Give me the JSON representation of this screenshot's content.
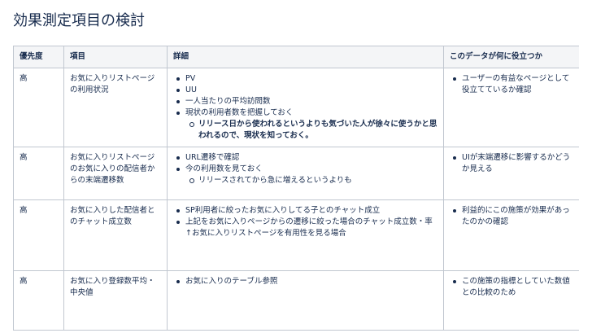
{
  "page": {
    "title": "効果測定項目の検討"
  },
  "table": {
    "headers": {
      "priority": "優先度",
      "item": "項目",
      "detail": "詳細",
      "usage": "このデータが何に役立つか"
    },
    "rows": [
      {
        "priority": "高",
        "item": "お気に入りリストページの利用状況",
        "detail": {
          "bullets": [
            "PV",
            "UU",
            "一人当たりの平均訪問数",
            "現状の利用者数を把握しておく"
          ],
          "sub": "リリース日から使われるというよりも気づいた人が徐々に使うかと思われるので、現状を知っておく。"
        },
        "usage": "ユーザーの有益なページとして役立てているか確認"
      },
      {
        "priority": "高",
        "item": "お気に入りリストページのお気に入りの配信者からの末端遷移数",
        "detail": {
          "bullets": [
            "URL遷移で確認",
            "今の利用数を見ておく"
          ],
          "sub": "リリースされてから急に増えるというよりも"
        },
        "usage": "UIが末端遷移に影響するかどうか見える"
      },
      {
        "priority": "高",
        "item": "お気に入りした配信者とのチャット成立数",
        "detail": {
          "bullets": [
            "SP利用者に絞ったお気に入りしてる子とのチャット成立",
            "上記をお気に入りページからの遷移に絞った場合のチャット成立数・率"
          ],
          "note": "↑お気に入りリストページを有用性を見る場合"
        },
        "usage": "利益的にこの施策が効果があったのかの確認"
      },
      {
        "priority": "高",
        "item": "お気に入り登録数平均・中央値",
        "detail": {
          "bullets": [
            "お気に入りのテーブル参照"
          ]
        },
        "usage": "この施策の指標としていた数値との比較のため"
      }
    ]
  }
}
